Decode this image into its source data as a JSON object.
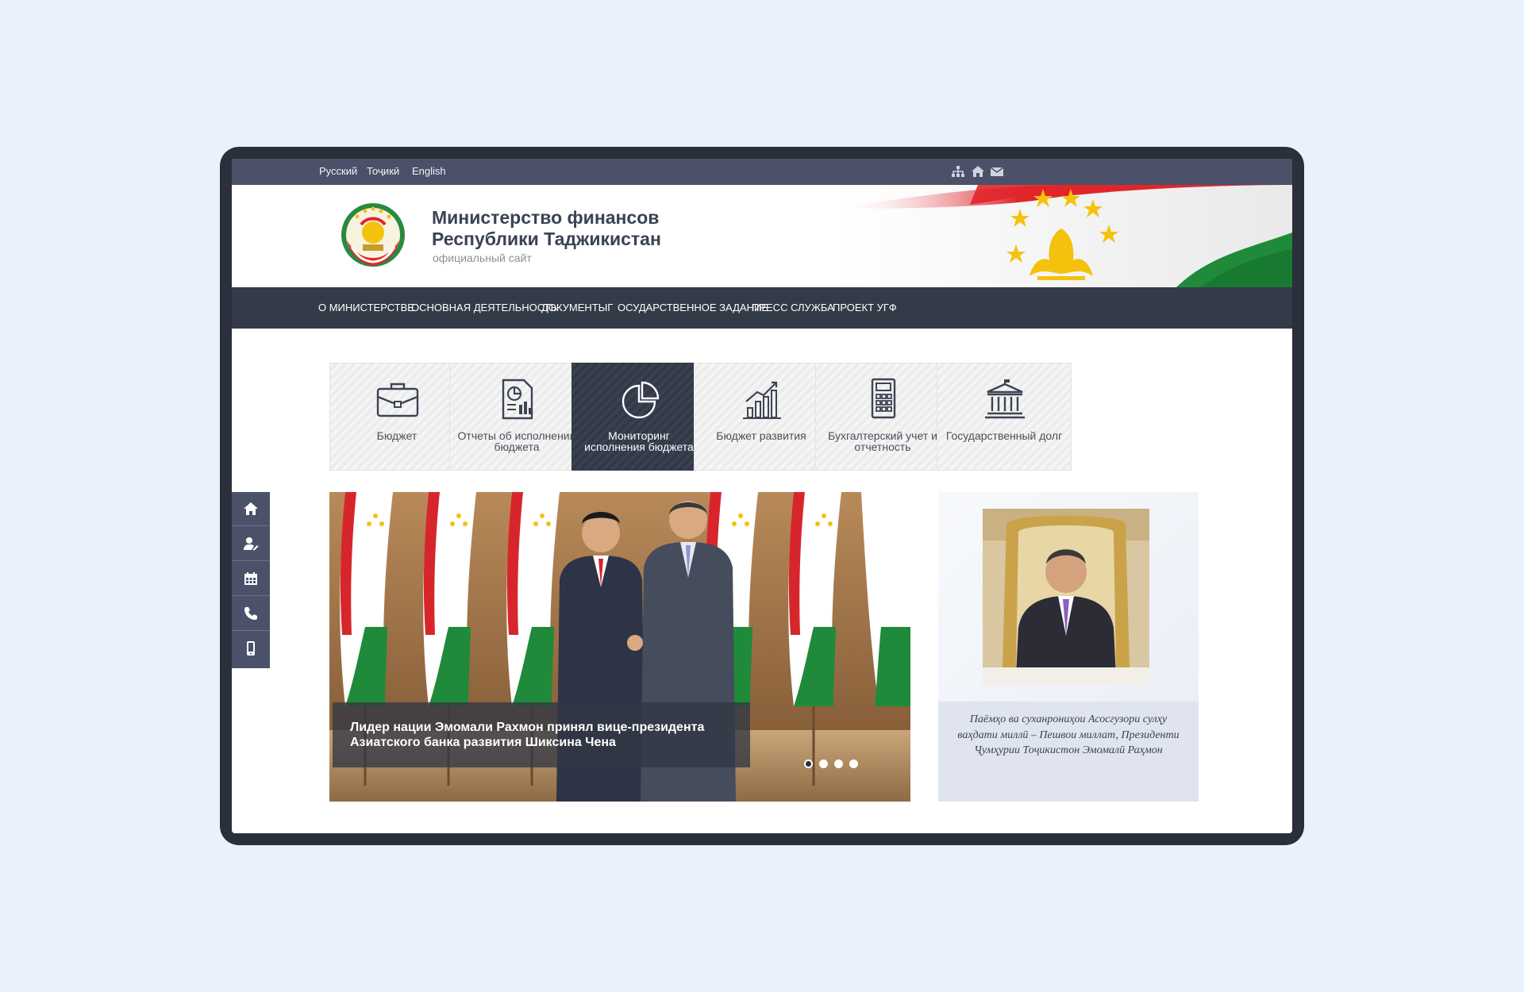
{
  "top_bar": {
    "languages": [
      "Русский",
      "Тоҷикӣ",
      "English"
    ],
    "icons": [
      "sitemap-icon",
      "home-icon",
      "mail-icon"
    ]
  },
  "header": {
    "title_line1": "Министерство финансов",
    "title_line2": "Республики Таджикистан",
    "subtitle": "официальный сайт"
  },
  "nav": {
    "items": [
      "О МИНИСТЕРСТВЕ",
      "ОСНОВНАЯ ДЕЯТЕЛЬНОСТЬ",
      "ДОКУМЕНТЫГ",
      "ОСУДАРСТВЕННОЕ ЗАДАНИЕ",
      "ПРЕСС СЛУЖБА",
      "ПРОЕКТ УГФ"
    ]
  },
  "tiles": [
    {
      "label": "Бюджет",
      "icon": "briefcase-icon",
      "active": false
    },
    {
      "label": "Отчеты об исполнении бюджета",
      "icon": "report-icon",
      "active": false
    },
    {
      "label": "Мониторинг исполнения бюджета",
      "icon": "pie-chart-icon",
      "active": true
    },
    {
      "label": "Бюджет развития",
      "icon": "bar-growth-icon",
      "active": false
    },
    {
      "label": "Бухгалтерский учет и отчетность",
      "icon": "calculator-icon",
      "active": false
    },
    {
      "label": "Государственный долг",
      "icon": "bank-icon",
      "active": false
    }
  ],
  "sidebar": {
    "icons": [
      "home-icon",
      "user-edit-icon",
      "calendar-icon",
      "phone-icon",
      "mobile-icon"
    ]
  },
  "slider": {
    "caption": "Лидер нации Эмомали Рахмон принял вице-президента Азиатского банка развития Шиксина Чена",
    "dots_total": 4,
    "active_dot": 1
  },
  "quote": {
    "text": "Паёмҳо ва суханрониҳои Асосгузори сулҳу ваҳдати миллӣ – Пешвои миллат, Президенти Ҷумҳурии Тоҷикистон Эмомалӣ Раҳмон"
  },
  "colors": {
    "top_bar": "#4a5169",
    "nav_bar": "#333a48",
    "frame": "#2a2f3b",
    "page_bg": "#e9f1fc",
    "flag_red": "#e0262b",
    "flag_green": "#1f8a3a",
    "gold": "#f4c20d"
  }
}
